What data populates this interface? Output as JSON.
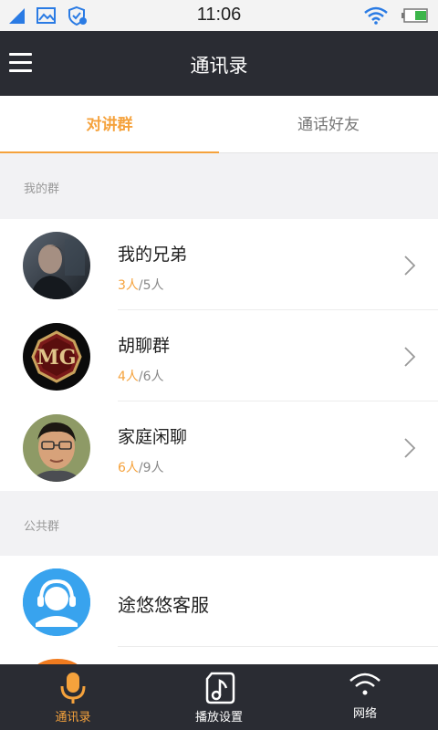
{
  "status_bar": {
    "time": "11:06"
  },
  "header": {
    "title": "通讯录"
  },
  "tabs": [
    {
      "label": "对讲群",
      "active": true
    },
    {
      "label": "通话好友",
      "active": false
    }
  ],
  "sections": {
    "my_groups": {
      "title": "我的群"
    },
    "public_groups": {
      "title": "公共群"
    }
  },
  "groups": [
    {
      "name": "我的兄弟",
      "online": "3人",
      "total": "/5人",
      "avatar": "movie-poster-avatar"
    },
    {
      "name": "胡聊群",
      "online": "4人",
      "total": "/6人",
      "avatar": "mg-logo-avatar"
    },
    {
      "name": "家庭闲聊",
      "online": "6人",
      "total": "/9人",
      "avatar": "man-glasses-avatar"
    }
  ],
  "public_groups": [
    {
      "name": "途悠悠客服",
      "avatar": "headset-service-avatar"
    }
  ],
  "bottom_nav": [
    {
      "label": "通讯录",
      "icon": "microphone-icon",
      "active": true
    },
    {
      "label": "播放设置",
      "icon": "music-note-icon",
      "active": false
    },
    {
      "label": "网络",
      "icon": "wifi-icon",
      "active": false
    }
  ],
  "colors": {
    "accent": "#f5a23c",
    "dark": "#2a2c33",
    "service_blue": "#38a3ee"
  }
}
